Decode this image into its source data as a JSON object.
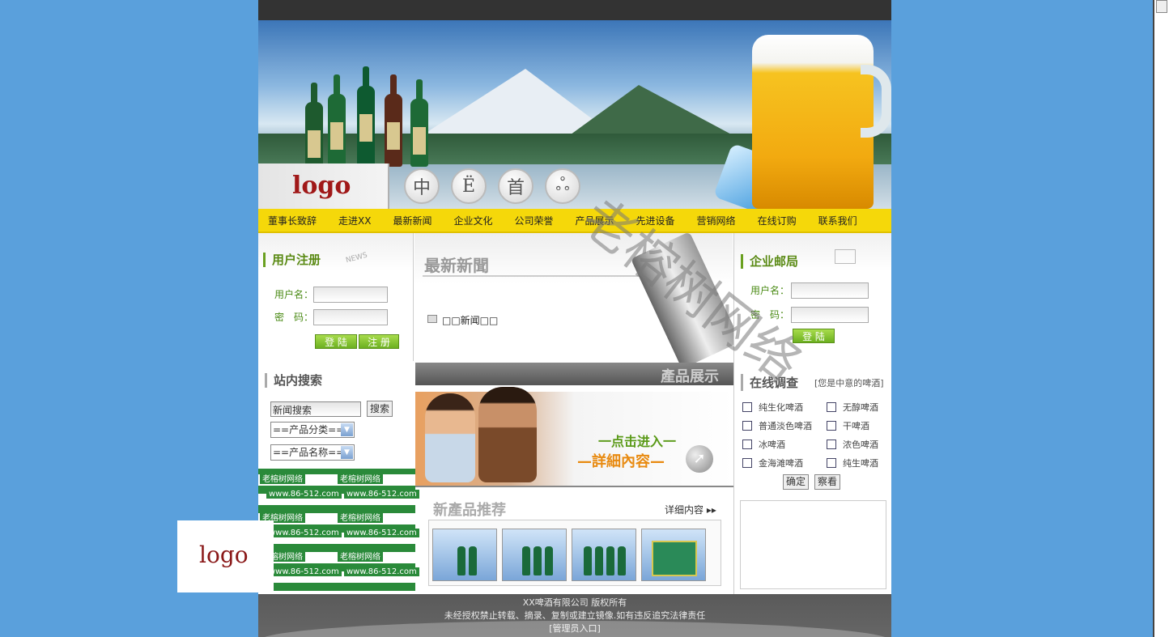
{
  "banner": {
    "logo": "logo",
    "circle_buttons": [
      "中",
      "Ё",
      "首",
      "ஃ"
    ]
  },
  "nav": [
    "董事长致辞",
    "走进XX",
    "最新新闻",
    "企业文化",
    "公司荣誉",
    "产品展示",
    "先进设备",
    "营销网络",
    "在线订购",
    "联系我们"
  ],
  "register": {
    "title": "用户注册",
    "badge": "NEWS",
    "username_label": "用户名：",
    "password_label": "密　码：",
    "login_btn": "登 陆",
    "register_btn": "注 册"
  },
  "news": {
    "title": "最新新聞",
    "item": "□□新闻□□"
  },
  "mail": {
    "title": "企业邮局",
    "username_label": "用户名：",
    "password_label": "密　码：",
    "login_btn": "登 陆"
  },
  "search": {
    "title": "站内搜索",
    "input_value": "新闻搜索",
    "button": "搜索",
    "select1": "==产品分类==",
    "select2": "==产品名称==",
    "watermark_text_a": "老榕树网络",
    "watermark_text_b": "www.86-512.com"
  },
  "products": {
    "bar_title": "產品展示",
    "promo_line1": "一点击进入一",
    "promo_line2": "—詳細內容—",
    "new_title": "新產品推荐",
    "more": "详细内容"
  },
  "survey": {
    "title": "在线调查",
    "question": "[您是中意的啤酒]",
    "options": [
      "纯生化啤酒",
      "无醇啤酒",
      "普通淡色啤酒",
      "干啤酒",
      "冰啤酒",
      "浓色啤酒",
      "金海滩啤酒",
      "纯生啤酒"
    ],
    "confirm": "确定",
    "view": "察看"
  },
  "footer": {
    "line1": "XX啤酒有限公司 版权所有",
    "line2": "未经授权禁止转载、摘录、复制或建立镜像.如有违反追究法律责任",
    "admin": "[管理员入口]"
  },
  "watermark": "老榕树网络",
  "overlay_logo": "logo",
  "colors": {
    "background": "#5aa0dc",
    "nav": "#f5d80a",
    "accent_green": "#6cb020",
    "logo_red": "#a01818"
  }
}
